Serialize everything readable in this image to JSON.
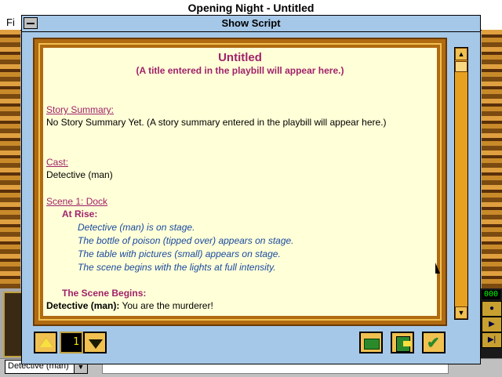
{
  "app": {
    "title": "Opening Night - Untitled",
    "menu_partial": "Fi"
  },
  "dialog": {
    "title": "Show Script"
  },
  "script": {
    "title": "Untitled",
    "subtitle": "(A title entered in the playbill will appear here.)",
    "summary_heading": "Story Summary:",
    "summary_text": "No Story Summary Yet.  (A story summary entered in the playbill will appear here.)",
    "cast_heading": "Cast:",
    "cast_list": [
      "Detective (man)"
    ],
    "scene_heading": "Scene 1: Dock",
    "at_rise_heading": "At Rise:",
    "stage_directions": [
      "Detective (man) is on stage.",
      "The bottle of poison (tipped over) appears on stage.",
      "The table with pictures (small) appears on stage.",
      "The scene begins with the lights at full intensity."
    ],
    "scene_begins_heading": "The Scene Begins:",
    "dialogue": [
      {
        "character": "Detective (man):",
        "line": "You are the murderer!"
      }
    ]
  },
  "controls": {
    "page_counter": "1",
    "page_up_icon": "triangle-up-icon",
    "page_down_icon": "triangle-down-icon",
    "open_icon": "folder-icon",
    "save_icon": "floppy-disk-icon",
    "ok_icon": "checkmark-icon"
  },
  "background": {
    "character_dropdown": "Detective (man)",
    "counter": "000"
  },
  "colors": {
    "dialog_bg": "#a6c8e8",
    "paper": "#ffffd8",
    "heading": "#a0226a",
    "stage_direction": "#1a4aa0",
    "frame": "#b06a10",
    "button": "#f0c050"
  }
}
